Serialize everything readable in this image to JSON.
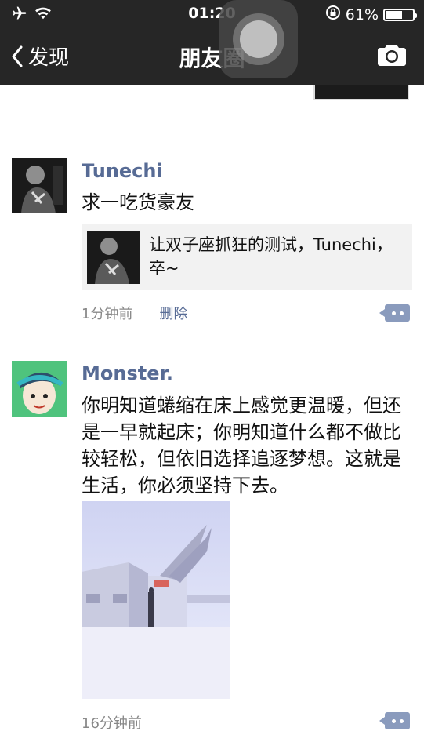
{
  "status_bar": {
    "time": "01:20",
    "battery_percent": "61%",
    "battery_level": 0.61,
    "icons": [
      "airplane-icon",
      "wifi-icon",
      "rotation-lock-icon",
      "battery-icon"
    ]
  },
  "nav": {
    "back_label": "发现",
    "title": "朋友圈",
    "camera_icon": "camera-icon"
  },
  "posts": [
    {
      "name": "Tunechi",
      "text": "求一吃货豪友",
      "share_text": "让双子座抓狂的测试，Tunechi，卒~",
      "time": "1分钟前",
      "delete_label": "删除"
    },
    {
      "name": "Monster.",
      "text": "你明知道蜷缩在床上感觉更温暖，但还是一早就起床；你明知道什么都不做比较轻松，但依旧选择追逐梦想。这就是生活，你必须坚持下去。",
      "time": "16分钟前"
    }
  ],
  "colors": {
    "nav_bg": "#262626",
    "name_link": "#576b95",
    "comment_button": "#8a9bbd"
  }
}
